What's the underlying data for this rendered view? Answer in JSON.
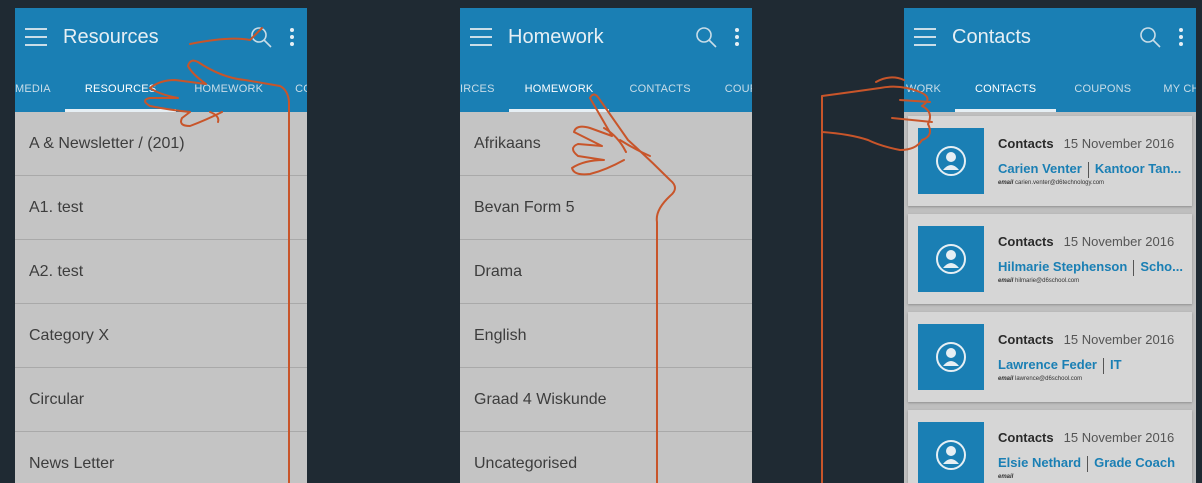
{
  "screens": [
    {
      "title": "Resources",
      "tabs": [
        "MEDIA",
        "RESOURCES",
        "HOMEWORK",
        "CONT"
      ],
      "active_tab": "RESOURCES",
      "items": [
        "A & Newsletter / (201)",
        "A1. test",
        "A2. test",
        "Category X",
        "Circular",
        "News Letter"
      ]
    },
    {
      "title": "Homework",
      "tabs": [
        "IRCES",
        "HOMEWORK",
        "CONTACTS",
        "COUP("
      ],
      "active_tab": "HOMEWORK",
      "items": [
        "Afrikaans",
        "Bevan Form 5",
        "Drama",
        "English",
        "Graad 4 Wiskunde",
        "Uncategorised"
      ]
    },
    {
      "title": "Contacts",
      "tabs": [
        "WORK",
        "CONTACTS",
        "COUPONS",
        "MY CHILI"
      ],
      "active_tab": "CONTACTS",
      "cards": [
        {
          "category": "Contacts",
          "date": "15 November 2016",
          "name": "Carien Venter",
          "role": "Kantoor Tan...",
          "email_label": "email",
          "email": "carien.venter@d6technology.com"
        },
        {
          "category": "Contacts",
          "date": "15 November 2016",
          "name": "Hilmarie Stephenson",
          "role": "Scho...",
          "email_label": "email",
          "email": "hilmarie@d6school.com"
        },
        {
          "category": "Contacts",
          "date": "15 November 2016",
          "name": "Lawrence Feder",
          "role": "IT",
          "email_label": "email",
          "email": "lawrence@d6school.com"
        },
        {
          "category": "Contacts",
          "date": "15 November 2016",
          "name": "Elsie Nethard",
          "role": "Grade Coach",
          "email_label": "email",
          "email": ""
        }
      ]
    }
  ],
  "colors": {
    "background": "#1f2a33",
    "appbar": "#1a7fb4",
    "list_bg": "#c4c4c4",
    "gesture_stroke": "#c8552a"
  },
  "icons": [
    "menu-icon",
    "search-icon",
    "more-vert-icon",
    "person-icon",
    "hand-gesture-icon"
  ]
}
